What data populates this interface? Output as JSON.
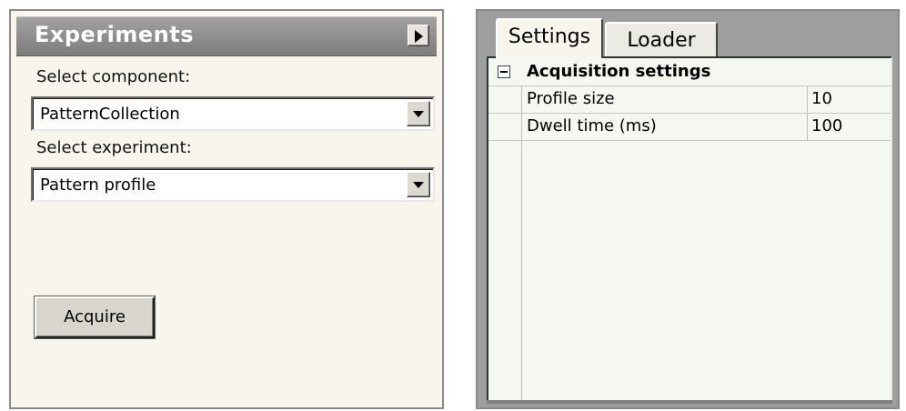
{
  "experiments_panel": {
    "title": "Experiments",
    "collapse_icon": "triangle-right-icon",
    "select_component_label": "Select component:",
    "component_value": "PatternCollection",
    "select_experiment_label": "Select experiment:",
    "experiment_value": "Pattern profile",
    "acquire_label": "Acquire"
  },
  "settings_panel": {
    "tabs": [
      {
        "label": "Settings",
        "active": true
      },
      {
        "label": "Loader",
        "active": false
      }
    ],
    "property_grid": {
      "category": "Acquisition settings",
      "collapse_icon": "minus-box-icon",
      "rows": [
        {
          "name": "Profile size",
          "value": "10"
        },
        {
          "name": "Dwell time (ms)",
          "value": "100"
        }
      ]
    }
  }
}
